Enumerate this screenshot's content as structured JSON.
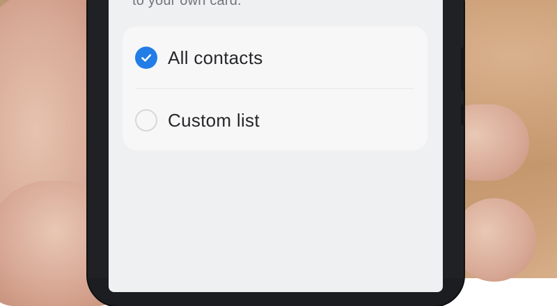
{
  "screen": {
    "caption": "to your own card."
  },
  "options": [
    {
      "label": "All contacts",
      "selected": true,
      "icon": "checkmark-icon"
    },
    {
      "label": "Custom list",
      "selected": false,
      "icon": "radio-empty-icon"
    }
  ],
  "colors": {
    "accent": "#1f7be6",
    "screen_bg": "#eff0f2",
    "card_bg": "#f7f7f8",
    "text": "#222326",
    "caption_text": "#6f7377"
  }
}
